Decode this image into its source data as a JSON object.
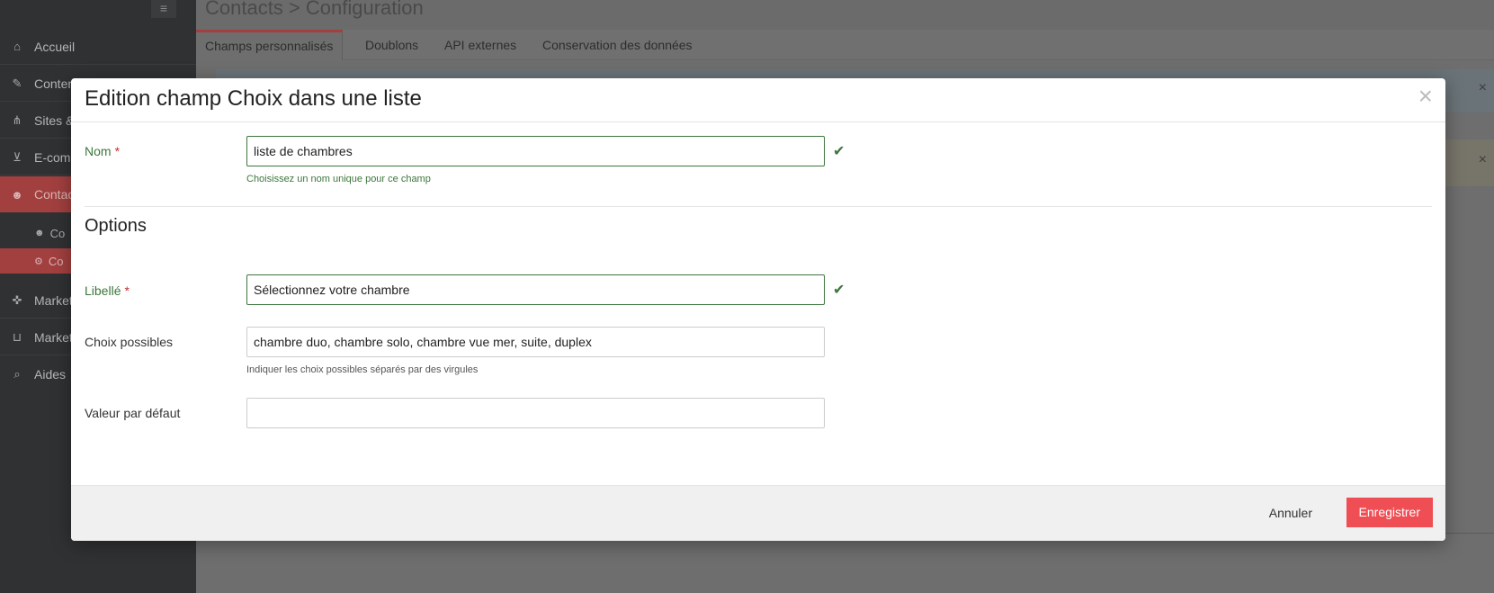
{
  "sidebar": {
    "items": [
      {
        "label": "Accueil",
        "icon": "home-icon",
        "glyph": "⌂"
      },
      {
        "label": "Conten",
        "icon": "edit-icon",
        "glyph": "✎"
      },
      {
        "label": "Sites &",
        "icon": "sitemap-icon",
        "glyph": "⋔"
      },
      {
        "label": "E-comm",
        "icon": "cart-icon",
        "glyph": "⊻"
      },
      {
        "label": "Contac",
        "icon": "users-icon",
        "glyph": "☻"
      },
      {
        "label": "Marketi",
        "icon": "crosshairs-icon",
        "glyph": "✜"
      },
      {
        "label": "Market",
        "icon": "basket-icon",
        "glyph": "⊔"
      },
      {
        "label": "Aides",
        "icon": "search-icon",
        "glyph": "⌕"
      }
    ],
    "sub_items": [
      {
        "label": "Co",
        "icon": "users-icon",
        "glyph": "☻"
      },
      {
        "label": "Co",
        "icon": "cogs-icon",
        "glyph": "⚙"
      }
    ],
    "menu_glyph": "≡"
  },
  "page": {
    "title": "Contacts > Configuration",
    "tabs": [
      {
        "label": "Champs personnalisés"
      },
      {
        "label": "Doublons"
      },
      {
        "label": "API externes"
      },
      {
        "label": "Conservation des données"
      }
    ],
    "close_glyph": "×"
  },
  "modal": {
    "title": "Edition champ Choix dans une liste",
    "close_glyph": "×",
    "name_label": "Nom",
    "required_mark": "*",
    "name_value": "liste de chambres",
    "name_help": "Choisissez un nom unique pour ce champ",
    "check_glyph": "✔",
    "options_title": "Options",
    "libelle_label": "Libellé",
    "libelle_value": "Sélectionnez votre chambre",
    "choices_label": "Choix possibles",
    "choices_value": "chambre duo, chambre solo, chambre vue mer, suite, duplex",
    "choices_help": "Indiquer les choix possibles séparés par des virgules",
    "default_label": "Valeur par défaut",
    "default_value": "",
    "cancel_label": "Annuler",
    "save_label": "Enregistrer"
  },
  "colors": {
    "accent": "#ef4e55",
    "valid": "#3c763d",
    "sidebar_active": "#a23f3f"
  }
}
